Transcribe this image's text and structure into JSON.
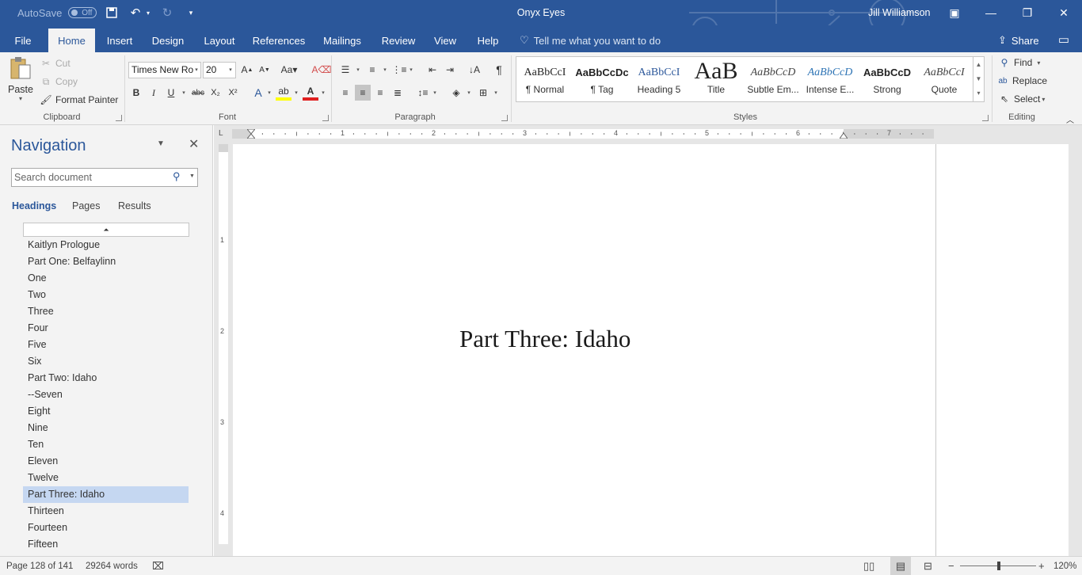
{
  "titlebar": {
    "autosave_label": "AutoSave",
    "autosave_state": "Off",
    "doc_title": "Onyx Eyes",
    "user_name": "Jill Williamson"
  },
  "tabs": [
    {
      "label": "File"
    },
    {
      "label": "Home"
    },
    {
      "label": "Insert"
    },
    {
      "label": "Design"
    },
    {
      "label": "Layout"
    },
    {
      "label": "References"
    },
    {
      "label": "Mailings"
    },
    {
      "label": "Review"
    },
    {
      "label": "View"
    },
    {
      "label": "Help"
    }
  ],
  "active_tab": "Home",
  "tell_me": "Tell me what you want to do",
  "share_label": "Share",
  "clipboard": {
    "paste": "Paste",
    "cut": "Cut",
    "copy": "Copy",
    "format_painter": "Format Painter",
    "group_label": "Clipboard"
  },
  "font": {
    "name": "Times New Ro",
    "size": "20",
    "group_label": "Font"
  },
  "paragraph": {
    "group_label": "Paragraph"
  },
  "styles": {
    "group_label": "Styles",
    "items": [
      {
        "sample": "AaBbCcI",
        "name": "¶ Normal"
      },
      {
        "sample": "AaBbCcDc",
        "name": "¶ Tag"
      },
      {
        "sample": "AaBbCcI",
        "name": "Heading 5"
      },
      {
        "sample": "AaB",
        "name": "Title"
      },
      {
        "sample": "AaBbCcD",
        "name": "Subtle Em..."
      },
      {
        "sample": "AaBbCcD",
        "name": "Intense E..."
      },
      {
        "sample": "AaBbCcD",
        "name": "Strong"
      },
      {
        "sample": "AaBbCcI",
        "name": "Quote"
      }
    ]
  },
  "editing": {
    "find": "Find",
    "replace": "Replace",
    "select": "Select",
    "group_label": "Editing"
  },
  "navigation": {
    "title": "Navigation",
    "search_placeholder": "Search document",
    "tabs": [
      "Headings",
      "Pages",
      "Results"
    ],
    "active_tab": "Headings",
    "headings": [
      "Kaitlyn Prologue",
      "Part One: Belfaylinn",
      "One",
      "Two",
      "Three",
      "Four",
      "Five",
      "Six",
      "Part Two: Idaho",
      "--Seven",
      "Eight",
      "Nine",
      "Ten",
      "Eleven",
      "Twelve",
      "Part Three: Idaho",
      "Thirteen",
      "Fourteen",
      "Fifteen"
    ],
    "selected_heading": "Part Three: Idaho"
  },
  "ruler": {
    "h_numbers": [
      "1",
      "2",
      "3",
      "4",
      "5",
      "6",
      "7"
    ],
    "v_numbers": [
      "1",
      "2",
      "3",
      "4"
    ]
  },
  "document": {
    "heading": "Part Three: Idaho"
  },
  "statusbar": {
    "page": "Page 128 of 141",
    "words": "29264 words",
    "zoom": "120%"
  },
  "colors": {
    "accent": "#2b579a",
    "selection": "#c5d7f1"
  }
}
